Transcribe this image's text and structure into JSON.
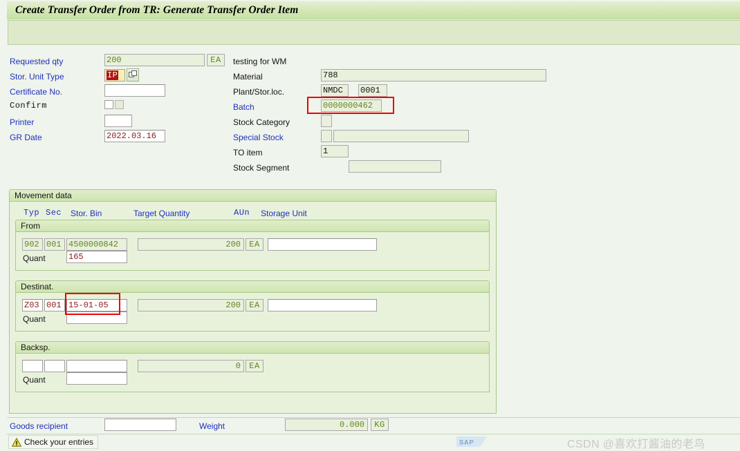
{
  "window": {
    "title": "Create Transfer Order from TR: Generate Transfer Order Item"
  },
  "left_form": {
    "requested_qty": {
      "label": "Requested qty",
      "value": "200",
      "unit": "EA"
    },
    "description": "testing for WM",
    "stor_unit_type": {
      "label": "Stor. Unit Type",
      "value": "IP"
    },
    "certificate_no": {
      "label": "Certificate No.",
      "value": ""
    },
    "confirm": {
      "label": "Confirm"
    },
    "printer": {
      "label": "Printer",
      "value": ""
    },
    "gr_date": {
      "label": "GR Date",
      "value": "2022.03.16"
    }
  },
  "right_form": {
    "material": {
      "label": "Material",
      "value": "788"
    },
    "plant_storloc": {
      "label": "Plant/Stor.loc.",
      "plant": "NMDC",
      "sloc": "0001"
    },
    "batch": {
      "label": "Batch",
      "value": "0000000462"
    },
    "stock_category": {
      "label": "Stock Category",
      "value": ""
    },
    "special_stock": {
      "label": "Special Stock",
      "value": "",
      "value2": ""
    },
    "to_item": {
      "label": "TO item",
      "value": "1"
    },
    "stock_segment": {
      "label": "Stock Segment",
      "value": ""
    }
  },
  "movement": {
    "title": "Movement data",
    "columns": {
      "typ": "Typ",
      "sec": "Sec",
      "stor_bin": "Stor. Bin",
      "target_quantity": "Target Quantity",
      "aun": "AUn",
      "storage_unit": "Storage Unit"
    },
    "from": {
      "title": "From",
      "typ": "902",
      "sec": "001",
      "stor_bin": "4500000842",
      "target_quantity": "200",
      "aun": "EA",
      "storage_unit": "",
      "quant_label": "Quant",
      "quant": "165"
    },
    "destination": {
      "title": "Destinat.",
      "typ": "Z03",
      "sec": "001",
      "stor_bin": "15-01-05",
      "target_quantity": "200",
      "aun": "EA",
      "storage_unit": "",
      "quant_label": "Quant",
      "quant": ""
    },
    "backspace": {
      "title": "Backsp.",
      "typ": "",
      "sec": "",
      "stor_bin": "",
      "target_quantity": "0",
      "aun": "EA",
      "storage_unit": "",
      "quant_label": "Quant",
      "quant": ""
    }
  },
  "footer": {
    "goods_recipient": {
      "label": "Goods recipient",
      "value": ""
    },
    "weight": {
      "label": "Weight",
      "value": "0.000",
      "unit": "KG"
    }
  },
  "status": {
    "message": "Check your entries",
    "icon": "warning-icon"
  },
  "branding": {
    "logo": "SAP",
    "watermark": "CSDN @喜欢打酱油的老鸟"
  },
  "colors": {
    "title_bar": "#d3e7b4",
    "panel": "#e8f2db",
    "page_bg": "#eff4ec",
    "readonly_text": "#5f8722",
    "editable_text": "#8b1a1a",
    "label_link": "#1f2fbf",
    "annotation": "#ef0000",
    "selection": "#b01414"
  }
}
